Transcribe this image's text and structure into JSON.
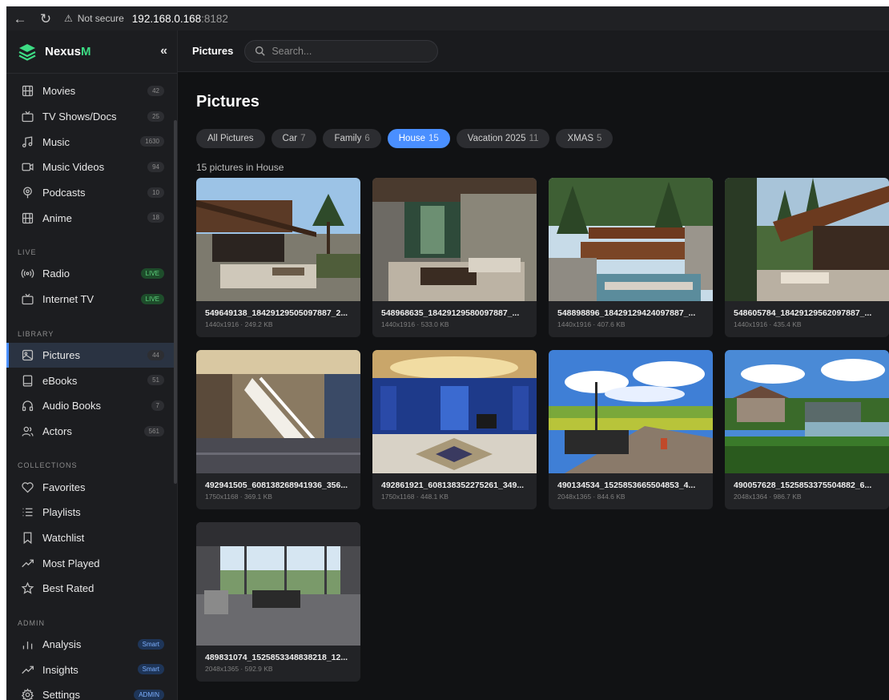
{
  "browser": {
    "back_icon": "arrow-left-icon",
    "reload_icon": "reload-icon",
    "security_label": "Not secure",
    "host": "192.168.0.168",
    "port": ":8182"
  },
  "app": {
    "brand": "Nexus",
    "brand_suffix": "M",
    "collapse_label": "«",
    "accent_color": "#4a8fff",
    "brand_color": "#3ddc84"
  },
  "sidebar": {
    "media_items": [
      {
        "label": "Movies",
        "badge": "42",
        "icon": "film-icon"
      },
      {
        "label": "TV Shows/Docs",
        "badge": "25",
        "icon": "tv-icon"
      },
      {
        "label": "Music",
        "badge": "1630",
        "icon": "music-icon"
      },
      {
        "label": "Music Videos",
        "badge": "94",
        "icon": "video-icon"
      },
      {
        "label": "Podcasts",
        "badge": "10",
        "icon": "podcast-icon"
      },
      {
        "label": "Anime",
        "badge": "18",
        "icon": "film-icon"
      }
    ],
    "live_label": "LIVE",
    "live_items": [
      {
        "label": "Radio",
        "badge": "LIVE",
        "icon": "radio-icon"
      },
      {
        "label": "Internet TV",
        "badge": "LIVE",
        "icon": "tv-icon"
      }
    ],
    "library_label": "LIBRARY",
    "library_items": [
      {
        "label": "Pictures",
        "badge": "44",
        "icon": "image-icon",
        "active": true
      },
      {
        "label": "eBooks",
        "badge": "51",
        "icon": "book-icon"
      },
      {
        "label": "Audio Books",
        "badge": "7",
        "icon": "headphones-icon"
      },
      {
        "label": "Actors",
        "badge": "561",
        "icon": "users-icon"
      }
    ],
    "collections_label": "COLLECTIONS",
    "collection_items": [
      {
        "label": "Favorites",
        "icon": "heart-icon"
      },
      {
        "label": "Playlists",
        "icon": "list-icon"
      },
      {
        "label": "Watchlist",
        "icon": "bookmark-icon"
      },
      {
        "label": "Most Played",
        "icon": "trending-icon"
      },
      {
        "label": "Best Rated",
        "icon": "star-icon"
      }
    ],
    "admin_label": "ADMIN",
    "admin_items": [
      {
        "label": "Analysis",
        "badge": "Smart",
        "icon": "bar-chart-icon"
      },
      {
        "label": "Insights",
        "badge": "Smart",
        "icon": "trending-icon"
      },
      {
        "label": "Settings",
        "badge": "ADMIN",
        "icon": "gear-icon"
      }
    ]
  },
  "topbar": {
    "breadcrumb": "Pictures",
    "search_placeholder": "Search..."
  },
  "main": {
    "title": "Pictures",
    "chips": [
      {
        "label": "All Pictures",
        "count": ""
      },
      {
        "label": "Car",
        "count": "7"
      },
      {
        "label": "Family",
        "count": "6"
      },
      {
        "label": "House",
        "count": "15",
        "active": true
      },
      {
        "label": "Vacation 2025",
        "count": "11"
      },
      {
        "label": "XMAS",
        "count": "5"
      }
    ],
    "count_text": "15 pictures in House",
    "pictures": [
      {
        "name": "549649138_18429129505097887_2...",
        "meta": "1440x1916 · 249.2 KB"
      },
      {
        "name": "548968635_18429129580097887_...",
        "meta": "1440x1916 · 533.0 KB"
      },
      {
        "name": "548898896_18429129424097887_...",
        "meta": "1440x1916 · 407.6 KB"
      },
      {
        "name": "548605784_18429129562097887_...",
        "meta": "1440x1916 · 435.4 KB"
      },
      {
        "name": "492941505_608138268941936_356...",
        "meta": "1750x1168 · 369.1 KB"
      },
      {
        "name": "492861921_608138352275261_349...",
        "meta": "1750x1168 · 448.1 KB"
      },
      {
        "name": "490134534_1525853665504853_4...",
        "meta": "2048x1365 · 844.6 KB"
      },
      {
        "name": "490057628_1525853375504882_6...",
        "meta": "2048x1364 · 986.7 KB"
      },
      {
        "name": "489831074_1525853348838218_12...",
        "meta": "2048x1365 · 592.9 KB"
      }
    ]
  }
}
